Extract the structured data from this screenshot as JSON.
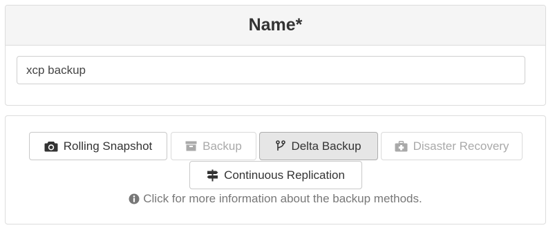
{
  "name_section": {
    "title": "Name*",
    "input_value": "xcp backup"
  },
  "backup_methods": {
    "buttons": [
      {
        "label": "Rolling Snapshot",
        "icon": "camera-icon",
        "state": "default"
      },
      {
        "label": "Backup",
        "icon": "archive-icon",
        "state": "disabled"
      },
      {
        "label": "Delta Backup",
        "icon": "code-fork-icon",
        "state": "active"
      },
      {
        "label": "Disaster Recovery",
        "icon": "medkit-icon",
        "state": "disabled"
      },
      {
        "label": "Continuous Replication",
        "icon": "map-signs-icon",
        "state": "default"
      }
    ],
    "info_text": "Click for more information about the backup methods.",
    "info_icon": "info-circle-icon"
  },
  "colors": {
    "header_bg": "#f5f5f5",
    "active_bg": "#e6e6e6",
    "disabled_text": "#a9a9a9",
    "info_text": "#777777"
  }
}
